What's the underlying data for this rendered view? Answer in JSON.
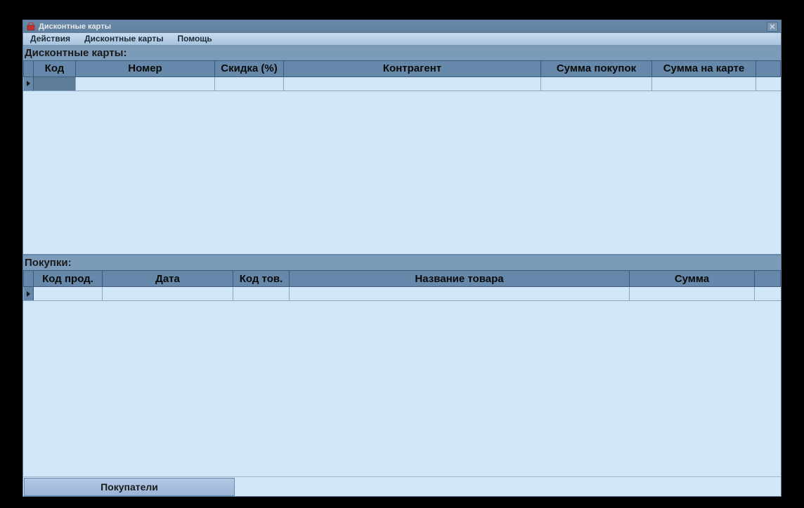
{
  "window": {
    "title": "Дисконтные карты"
  },
  "menubar": {
    "items": [
      "Действия",
      "Дисконтные карты",
      "Помощь"
    ]
  },
  "topSection": {
    "label": "Дисконтные карты:",
    "columns": [
      "Код",
      "Номер",
      "Скидка (%)",
      "Контрагент",
      "Сумма покупок",
      "Сумма на карте"
    ],
    "rows": [
      {
        "code": "",
        "number": "",
        "discount": "",
        "contractor": "",
        "purchaseTotal": "",
        "cardTotal": ""
      }
    ]
  },
  "bottomSection": {
    "label": "Покупки:",
    "columns": [
      "Код прод.",
      "Дата",
      "Код тов.",
      "Название товара",
      "Сумма"
    ],
    "rows": [
      {
        "saleCode": "",
        "date": "",
        "itemCode": "",
        "itemName": "",
        "amount": ""
      }
    ]
  },
  "footer": {
    "buyersButton": "Покупатели"
  }
}
